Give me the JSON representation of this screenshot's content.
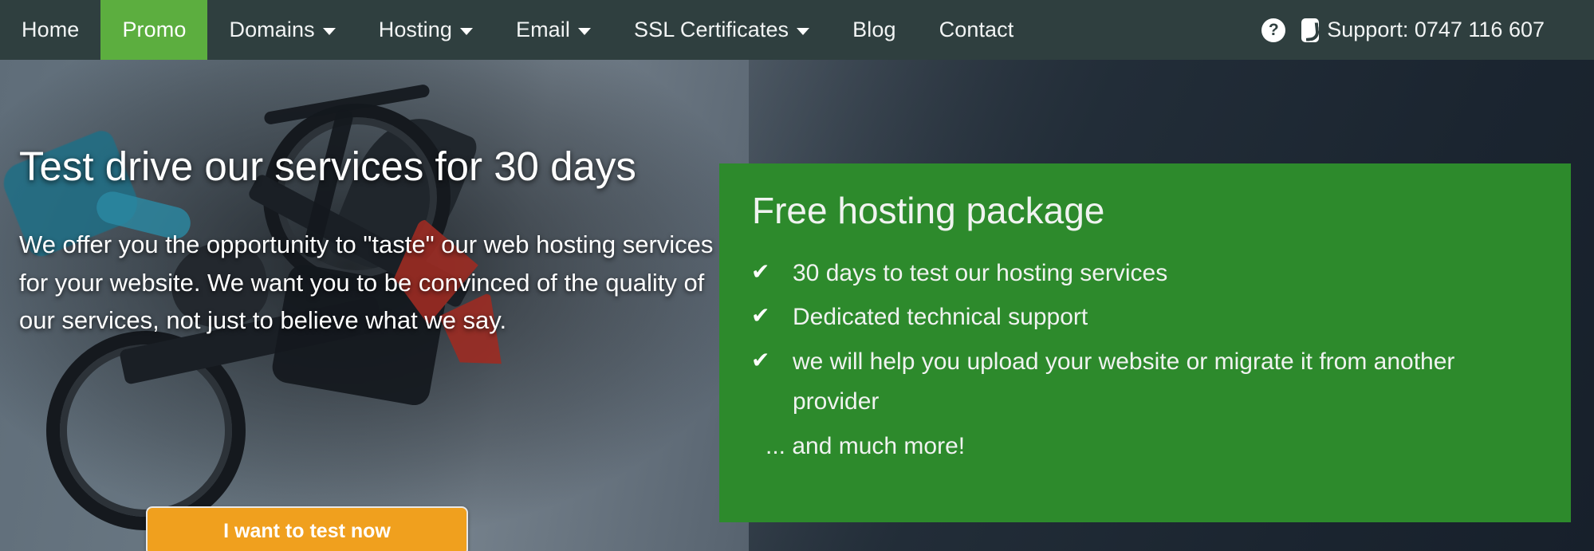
{
  "navbar": {
    "items": [
      {
        "label": "Home",
        "has_caret": false,
        "active": false
      },
      {
        "label": "Promo",
        "has_caret": false,
        "active": true
      },
      {
        "label": "Domains",
        "has_caret": true,
        "active": false
      },
      {
        "label": "Hosting",
        "has_caret": true,
        "active": false
      },
      {
        "label": "Email",
        "has_caret": true,
        "active": false
      },
      {
        "label": "SSL Certificates",
        "has_caret": true,
        "active": false
      },
      {
        "label": "Blog",
        "has_caret": false,
        "active": false
      },
      {
        "label": "Contact",
        "has_caret": false,
        "active": false
      }
    ],
    "help_icon": "question-mark-icon",
    "help_glyph": "?",
    "phone_icon": "phone-icon",
    "support_text": "Support: 0747 116 607",
    "bg_color": "#2f3f3f",
    "active_color": "#5cae3f"
  },
  "hero": {
    "title": "Test drive our services for 30 days",
    "paragraph": "We offer you the opportunity to \"taste\" our web hosting services for your website. We want you to be convinced of the quality of our services, not just to believe what we say.",
    "cta_label": "I want to test now",
    "cta_color": "#f0a01e"
  },
  "promo_card": {
    "title": "Free hosting package",
    "bg_color": "#2d8a2c",
    "check_glyph": "✔",
    "items": [
      "30 days to test our hosting services",
      "Dedicated technical support",
      " we will help you upload your website or migrate it from another provider"
    ],
    "more_text": "... and much more!"
  }
}
